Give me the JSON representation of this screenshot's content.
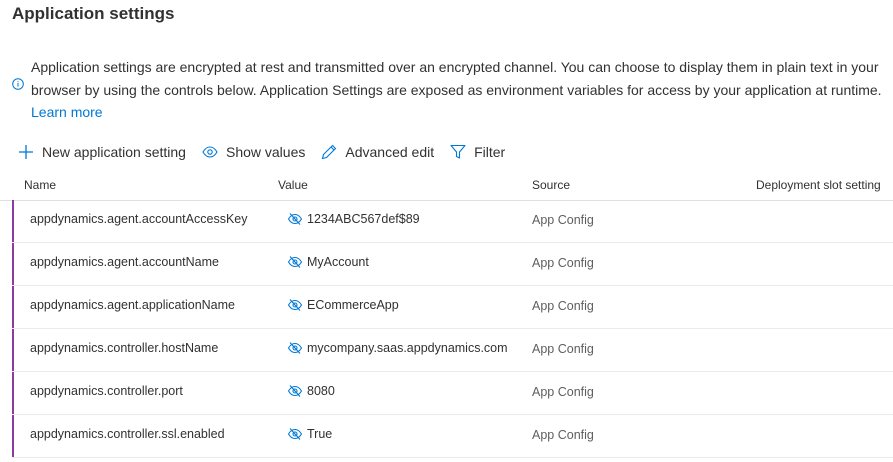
{
  "page": {
    "title": "Application settings",
    "info_text": "Application settings are encrypted at rest and transmitted over an encrypted channel. You can choose to display them in plain text in your browser by using the controls below. Application Settings are exposed as environment variables for access by your application at runtime.",
    "learn_more": "Learn more"
  },
  "toolbar": {
    "new_setting": "New application setting",
    "show_values": "Show values",
    "advanced_edit": "Advanced edit",
    "filter": "Filter"
  },
  "table": {
    "headers": {
      "name": "Name",
      "value": "Value",
      "source": "Source",
      "slot": "Deployment slot setting"
    },
    "rows": [
      {
        "name": "appdynamics.agent.accountAccessKey",
        "value": "1234ABC567def$89",
        "source": "App Config"
      },
      {
        "name": "appdynamics.agent.accountName",
        "value": "MyAccount",
        "source": "App Config"
      },
      {
        "name": "appdynamics.agent.applicationName",
        "value": "ECommerceApp",
        "source": "App Config"
      },
      {
        "name": "appdynamics.controller.hostName",
        "value": "mycompany.saas.appdynamics.com",
        "source": "App Config"
      },
      {
        "name": "appdynamics.controller.port",
        "value": "8080",
        "source": "App Config"
      },
      {
        "name": "appdynamics.controller.ssl.enabled",
        "value": "True",
        "source": "App Config"
      }
    ]
  },
  "colors": {
    "accent": "#0078d4",
    "row_marker": "#8a3d9e"
  },
  "icons": {
    "info": "info-icon",
    "add": "plus-icon",
    "show": "eye-icon",
    "edit": "pencil-icon",
    "filter": "filter-icon",
    "value_visibility": "eye-slash-icon"
  }
}
